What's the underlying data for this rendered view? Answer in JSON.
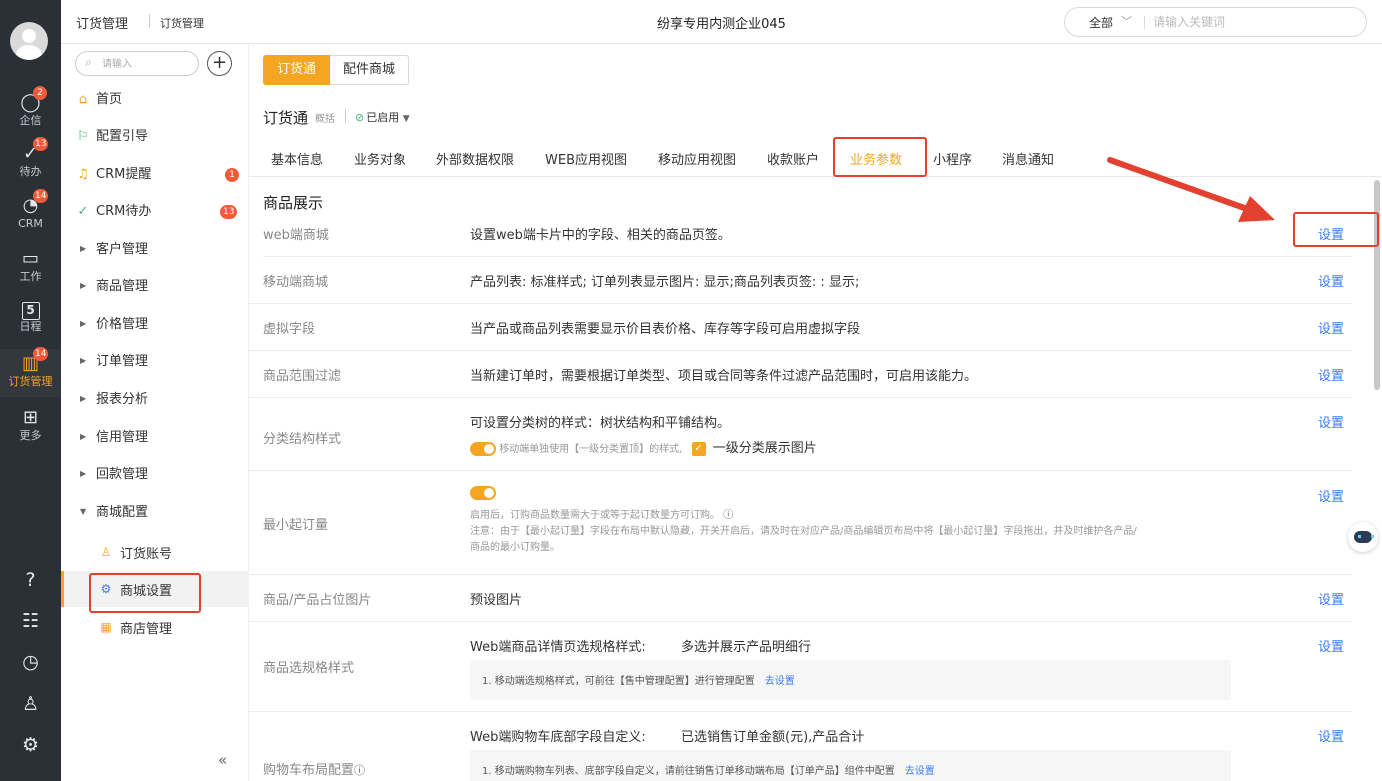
{
  "rail": {
    "items": [
      {
        "label": "企信",
        "badge": "2",
        "icon": "chat-bubble-icon"
      },
      {
        "label": "待办",
        "badge": "13",
        "icon": "check-circle-icon"
      },
      {
        "label": "CRM",
        "badge": "14",
        "icon": "pie-chart-icon"
      },
      {
        "label": "工作",
        "badge": "",
        "icon": "briefcase-icon"
      },
      {
        "label": "日程",
        "badge": "",
        "icon": "calendar-icon",
        "day": "5"
      },
      {
        "label": "订货管理",
        "badge": "14",
        "icon": "order-icon"
      },
      {
        "label": "更多",
        "badge": "",
        "icon": "grid-icon"
      }
    ],
    "bottom_icons": [
      "help-icon",
      "form-icon",
      "clock-icon",
      "user-list-icon",
      "settings-icon"
    ]
  },
  "topbar": {
    "crumb_main": "订货管理",
    "crumb_sub": "订货管理",
    "company": "纷享专用内测企业045",
    "search_scope": "全部",
    "search_placeholder": "请输入关键词"
  },
  "leftnav": {
    "search_placeholder": "请输入",
    "items": [
      {
        "label": "首页",
        "icon": "home-icon"
      },
      {
        "label": "配置引导",
        "icon": "guide-icon"
      },
      {
        "label": "CRM提醒",
        "icon": "bell-icon",
        "badge": "1"
      },
      {
        "label": "CRM待办",
        "icon": "check-circle-icon",
        "badge": "13"
      },
      {
        "label": "客户管理"
      },
      {
        "label": "商品管理"
      },
      {
        "label": "价格管理"
      },
      {
        "label": "订单管理"
      },
      {
        "label": "报表分析"
      },
      {
        "label": "信用管理"
      },
      {
        "label": "回款管理"
      },
      {
        "label": "商城配置",
        "expanded": true
      }
    ],
    "sub_items": [
      {
        "label": "订货账号",
        "icon": "account-icon"
      },
      {
        "label": "商城设置",
        "icon": "settings-icon",
        "active": true
      },
      {
        "label": "商店管理",
        "icon": "store-icon"
      }
    ],
    "collapse_glyph": "«"
  },
  "main": {
    "seg_tabs": [
      "订货通",
      "配件商城"
    ],
    "title": "订货通",
    "subtitle": "概括",
    "status": "已启用",
    "tabs": [
      "基本信息",
      "业务对象",
      "外部数据权限",
      "WEB应用视图",
      "移动应用视图",
      "收款账户",
      "业务参数",
      "小程序",
      "消息通知"
    ],
    "active_tab": "业务参数",
    "section_title": "商品展示",
    "set_label": "设置",
    "rows": {
      "web_mall": {
        "label": "web端商城",
        "desc": "设置web端卡片中的字段、相关的商品页签。"
      },
      "mobile_mall": {
        "label": "移动端商城",
        "desc": "产品列表: 标准样式; 订单列表显示图片: 显示;商品列表页签: : 显示;"
      },
      "virtual_field": {
        "label": "虚拟字段",
        "desc": "当产品或商品列表需要显示价目表价格、库存等字段可启用虚拟字段"
      },
      "range_filter": {
        "label": "商品范围过滤",
        "desc": "当新建订单时，需要根据订单类型、项目或合同等条件过滤产品范围时，可启用该能力。"
      },
      "category_style": {
        "label": "分类结构样式",
        "desc": "可设置分类树的样式：树状结构和平铺结构。",
        "toggle_note": "移动端单独使用【一级分类置顶】的样式,",
        "check_label": "一级分类展示图片"
      },
      "min_order": {
        "label": "最小起订量",
        "note1": "启用后，订购商品数量需大于或等于起订数量方可订购。",
        "note2": "注意：由于【最小起订量】字段在布局中默认隐藏，开关开启后，请及时在对应产品/商品编辑页布局中将【最小起订量】字段拖出，并及时维护各产品/",
        "note3": "商品的最小订购量。"
      },
      "placeholder_img": {
        "label": "商品/产品占位图片",
        "desc": "预设图片"
      },
      "spec_style": {
        "label": "商品选规格样式",
        "desc_key": "Web端商品详情页选规格样式:",
        "desc_val": "多选并展示产品明细行",
        "note": "1. 移动端选规格样式，可前往【售中管理配置】进行管理配置",
        "link": "去设置"
      },
      "cart_layout": {
        "label": "购物车布局配置",
        "desc_key": "Web端购物车底部字段自定义:",
        "desc_val": "已选销售订单金额(元),产品合计",
        "note": "1. 移动端购物车列表、底部字段自定义，请前往销售订单移动端布局【订单产品】组件中配置",
        "link": "去设置"
      }
    }
  },
  "colors": {
    "accent": "#f4a623",
    "link": "#3a7cf5",
    "highlight": "#e4402f",
    "rail_bg": "#2b2f36"
  }
}
